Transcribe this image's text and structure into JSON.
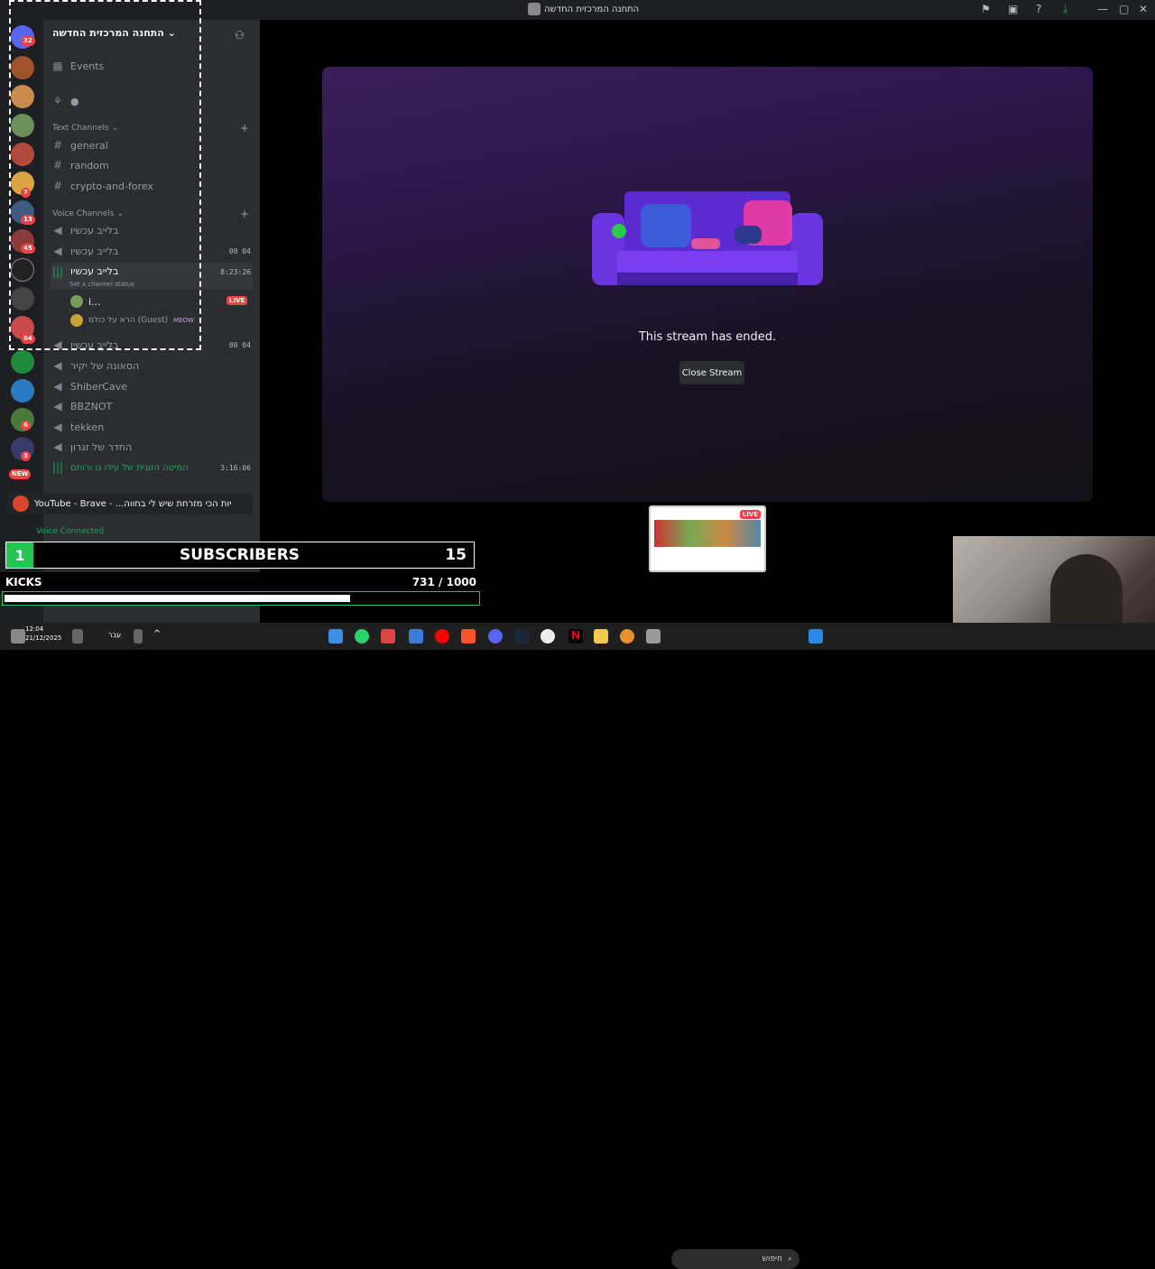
{
  "window": {
    "title": "התחנה המרכזית החדשה"
  },
  "guild_badges": [
    "32",
    "7",
    "13",
    "45",
    "64",
    "6",
    "3",
    "NEW"
  ],
  "server": {
    "name": "התחנה המרכזית החדשה",
    "events_label": "Events"
  },
  "text_category": "Text Channels",
  "text_channels": [
    "general",
    "random",
    "crypto-and-forex"
  ],
  "voice_category": "Voice Channels",
  "voice_channels": [
    {
      "name": "בלייב עכשיו",
      "timer": ""
    },
    {
      "name": "בלייב עכשיו",
      "timer": "00 04"
    },
    {
      "name": "בלייב עכשיו",
      "timer": "8:23:26",
      "status": "Set a channel status"
    },
    {
      "name": "בלייב עכשיו",
      "timer": "00 04"
    },
    {
      "name": "הסאונה של יקיר",
      "timer": ""
    },
    {
      "name": "ShiberCave",
      "timer": ""
    },
    {
      "name": "BBZNOT",
      "timer": ""
    },
    {
      "name": "tekken",
      "timer": ""
    },
    {
      "name": "החדר של זגרון",
      "timer": ""
    },
    {
      "name": "המיטה הזוגית של עידו גו ורותם",
      "timer": "3:16:06"
    }
  ],
  "voice_users": [
    {
      "name": "i...",
      "badge": "LIVE"
    },
    {
      "name": "הרא על כולם (Guest)",
      "badge": "MEOW"
    }
  ],
  "stage": {
    "message": "This stream has ended.",
    "close_label": "Close Stream"
  },
  "thumbnail": {
    "live_label": "LIVE"
  },
  "youtube_bar": {
    "title": "YouTube - Brave - ...יות הכי מזרחת שיש לי בחווה"
  },
  "voice_connected": "Voice Connected",
  "overlay": {
    "rank": "1",
    "subscribers_label": "SUBSCRIBERS",
    "subscribers_count": "15",
    "kicks_label": "KICKS",
    "kicks_value": "731  / 1000",
    "kicks_progress": 0.731
  },
  "taskbar": {
    "time": "12:04",
    "date": "21/12/2025",
    "search_placeholder": "חיפוש",
    "lang": "עבר"
  }
}
